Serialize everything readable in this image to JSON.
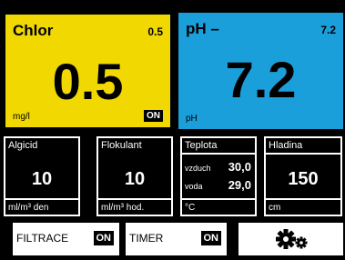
{
  "chlor": {
    "title": "Chlor",
    "setpoint": "0.5",
    "value": "0.5",
    "unit": "mg/l",
    "status": "ON"
  },
  "ph": {
    "title": "pH –",
    "setpoint": "7.2",
    "value": "7.2",
    "unit": "pH"
  },
  "algicid": {
    "title": "Algicid",
    "value": "10",
    "unit": "ml/m³ den"
  },
  "flokulant": {
    "title": "Flokulant",
    "value": "10",
    "unit": "ml/m³ hod."
  },
  "teplota": {
    "title": "Teplota",
    "air_label": "vzduch",
    "air_value": "30,0",
    "water_label": "voda",
    "water_value": "29,0",
    "unit": "°C"
  },
  "hladina": {
    "title": "Hladina",
    "value": "150",
    "unit": "cm"
  },
  "bottom": {
    "filtrace_label": "FILTRACE",
    "filtrace_status": "ON",
    "timer_label": "TIMER",
    "timer_status": "ON"
  },
  "colors": {
    "chlor_bg": "#f1d800",
    "ph_bg": "#1b9fdb"
  },
  "icons": {
    "settings": "gears-icon"
  }
}
